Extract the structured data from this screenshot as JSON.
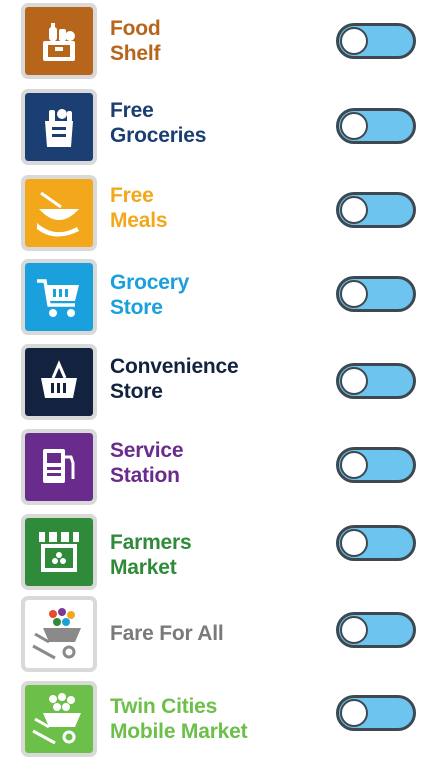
{
  "items": [
    {
      "line1": "Food",
      "line2": "Shelf",
      "icon": "food-shelf-icon",
      "color": "#b8651c",
      "tile_color": "#b8651c",
      "enabled": false
    },
    {
      "line1": "Free",
      "line2": "Groceries",
      "icon": "grocery-bag-icon",
      "color": "#1c3f73",
      "tile_color": "#1c3f73",
      "enabled": false
    },
    {
      "line1": "Free",
      "line2": "Meals",
      "icon": "meal-bowl-icon",
      "color": "#f3a81c",
      "tile_color": "#f3a81c",
      "enabled": false
    },
    {
      "line1": "Grocery",
      "line2": "Store",
      "icon": "shopping-cart-icon",
      "color": "#1aa0dc",
      "tile_color": "#1aa0dc",
      "enabled": false
    },
    {
      "line1": "Convenience",
      "line2": "Store",
      "icon": "shopping-basket-icon",
      "color": "#13233f",
      "tile_color": "#13233f",
      "enabled": false
    },
    {
      "line1": "Service",
      "line2": "Station",
      "icon": "fuel-pump-icon",
      "color": "#6a2c8c",
      "tile_color": "#6a2c8c",
      "enabled": false
    },
    {
      "line1": "Farmers",
      "line2": "Market",
      "icon": "market-stall-icon",
      "color": "#2f8a3a",
      "tile_color": "#2f8a3a",
      "enabled": false
    },
    {
      "line1": "Fare For All",
      "line2": "",
      "icon": "produce-wheelbarrow-icon",
      "color": "#7a7a7a",
      "tile_color": "#ffffff",
      "enabled": false
    },
    {
      "line1": "Twin Cities",
      "line2": "Mobile Market",
      "icon": "mobile-market-wheelbarrow-icon",
      "color": "#6cc04a",
      "tile_color": "#6cc04a",
      "enabled": false
    }
  ],
  "toggle_colors": {
    "track": "#6cc4ef",
    "outline": "#3e4850",
    "knob": "#ffffff"
  }
}
